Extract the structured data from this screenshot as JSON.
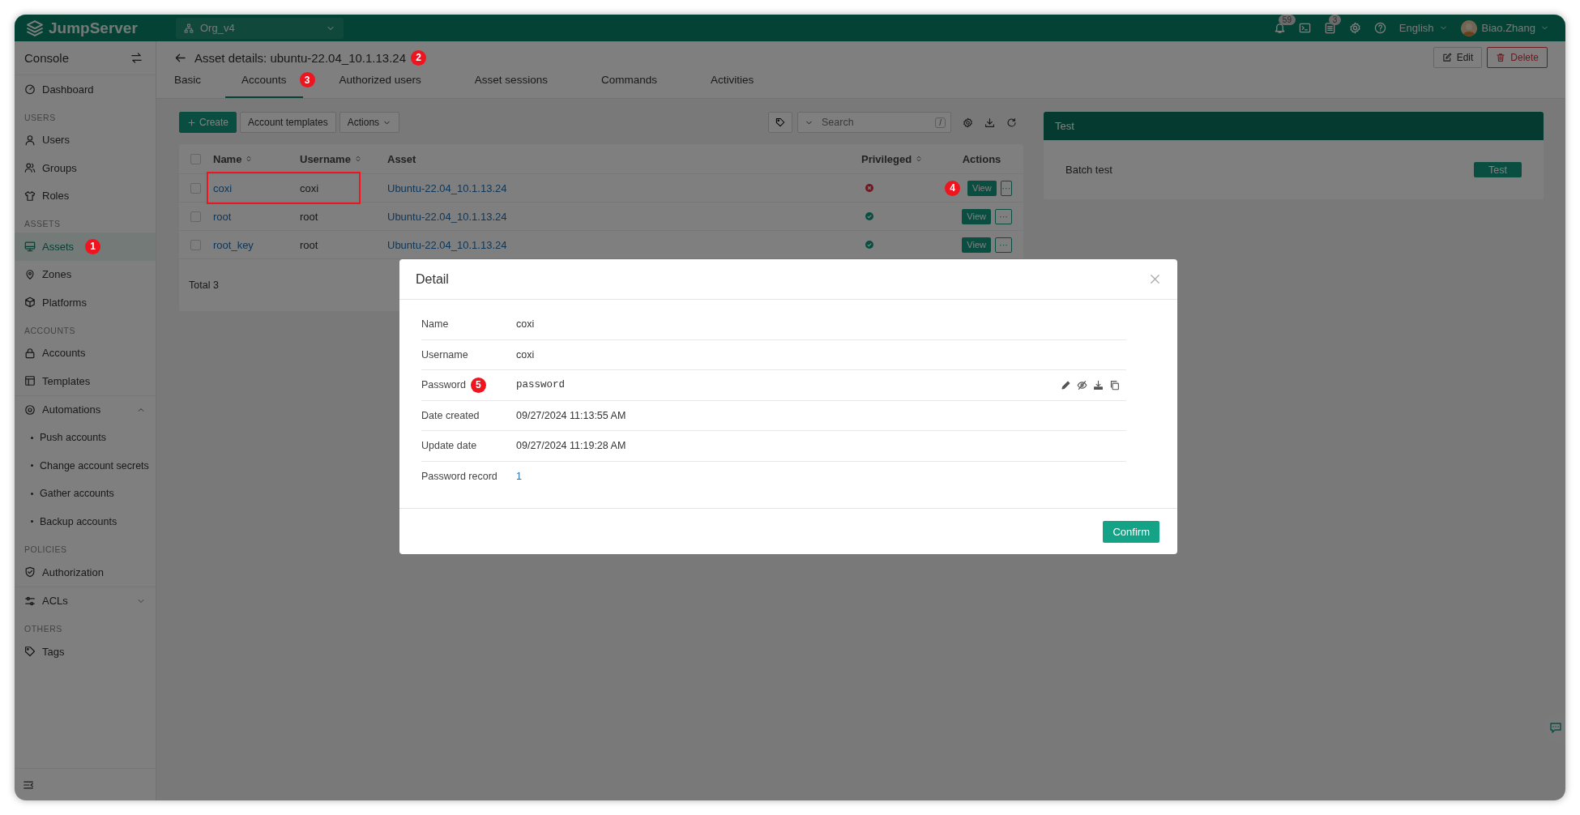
{
  "topbar": {
    "logo": "JumpServer",
    "org": "Org_v4",
    "notification_count": "59",
    "task_count": "3",
    "language": "English",
    "user": "Biao.Zhang"
  },
  "sidebar": {
    "title": "Console",
    "sections": [
      {
        "items": [
          {
            "label": "Dashboard",
            "kind": "item",
            "selected": false
          }
        ]
      },
      {
        "heading": "USERS",
        "items": [
          {
            "label": "Users",
            "kind": "item",
            "selected": false
          },
          {
            "label": "Groups",
            "kind": "item",
            "selected": false
          },
          {
            "label": "Roles",
            "kind": "item",
            "selected": false
          }
        ]
      },
      {
        "heading": "ASSETS",
        "items": [
          {
            "label": "Assets",
            "kind": "item",
            "selected": true,
            "annotation": "1"
          },
          {
            "label": "Zones",
            "kind": "item",
            "selected": false
          },
          {
            "label": "Platforms",
            "kind": "item",
            "selected": false
          }
        ]
      },
      {
        "heading": "ACCOUNTS",
        "items": [
          {
            "label": "Accounts",
            "kind": "item",
            "selected": false
          },
          {
            "label": "Templates",
            "kind": "item",
            "selected": false
          },
          {
            "label": "Automations",
            "kind": "group",
            "selected": false,
            "expanded": true,
            "children": [
              {
                "label": "Push accounts",
                "selected": false
              },
              {
                "label": "Change account secrets",
                "selected": false
              },
              {
                "label": "Gather accounts",
                "selected": false
              },
              {
                "label": "Backup accounts",
                "selected": false
              }
            ]
          }
        ]
      },
      {
        "heading": "POLICIES",
        "items": [
          {
            "label": "Authorization",
            "kind": "item",
            "selected": false
          },
          {
            "label": "ACLs",
            "kind": "group",
            "selected": false,
            "expanded": false
          }
        ]
      },
      {
        "heading": "OTHERS",
        "items": [
          {
            "label": "Tags",
            "kind": "item",
            "selected": false
          }
        ]
      }
    ]
  },
  "page": {
    "title": "Asset details: ubuntu-22.04_10.1.13.24",
    "annotation": "2",
    "buttons": [
      {
        "label": "Edit",
        "kind": "edit"
      },
      {
        "label": "Delete",
        "kind": "delete"
      }
    ],
    "tabs": [
      {
        "label": "Basic",
        "selected": false
      },
      {
        "label": "Accounts",
        "selected": true,
        "annotation": "3"
      },
      {
        "label": "Authorized users",
        "selected": false
      },
      {
        "label": "Asset sessions",
        "selected": false
      },
      {
        "label": "Commands",
        "selected": false
      },
      {
        "label": "Activities",
        "selected": false
      }
    ]
  },
  "toolbar": {
    "buttons": [
      {
        "label": "Create",
        "kind": "create"
      },
      {
        "label": "Account templates",
        "kind": "plain"
      },
      {
        "label": "Actions",
        "kind": "dropdown"
      }
    ],
    "search": {
      "placeholder": "Search",
      "shortcut": "/"
    }
  },
  "table": {
    "columns": [
      {
        "label": "Name",
        "sortable": true
      },
      {
        "label": "Username",
        "sortable": true
      },
      {
        "label": "Asset",
        "sortable": false
      },
      {
        "label": "Privileged",
        "sortable": true
      },
      {
        "label": "Actions",
        "sortable": false
      }
    ],
    "all_checked": false,
    "rows": [
      {
        "checked": false,
        "name": "coxi",
        "username": "coxi",
        "asset": "Ubuntu-22.04_10.1.13.24",
        "privileged": false,
        "action": "View",
        "more": "···",
        "highlighted": true,
        "annotation": "4"
      },
      {
        "checked": false,
        "name": "root",
        "username": "root",
        "asset": "Ubuntu-22.04_10.1.13.24",
        "privileged": true,
        "action": "View",
        "more": "···",
        "highlighted": false
      },
      {
        "checked": false,
        "name": "root_key",
        "username": "root",
        "asset": "Ubuntu-22.04_10.1.13.24",
        "privileged": true,
        "action": "View",
        "more": "···",
        "highlighted": false
      }
    ],
    "total": "Total 3"
  },
  "test_card": {
    "title": "Test",
    "label": "Batch test",
    "button": "Test"
  },
  "dialog": {
    "open": true,
    "title": "Detail",
    "fields": [
      {
        "label": "Name",
        "value": "coxi",
        "kind": "text"
      },
      {
        "label": "Username",
        "value": "coxi",
        "kind": "text"
      },
      {
        "label": "Password",
        "value": "password",
        "kind": "secret",
        "annotation": "5"
      },
      {
        "label": "Date created",
        "value": "09/27/2024 11:13:55 AM",
        "kind": "text"
      },
      {
        "label": "Update date",
        "value": "09/27/2024 11:19:28 AM",
        "kind": "text"
      },
      {
        "label": "Password record",
        "value": "1",
        "kind": "link"
      }
    ],
    "button": "Confirm"
  }
}
